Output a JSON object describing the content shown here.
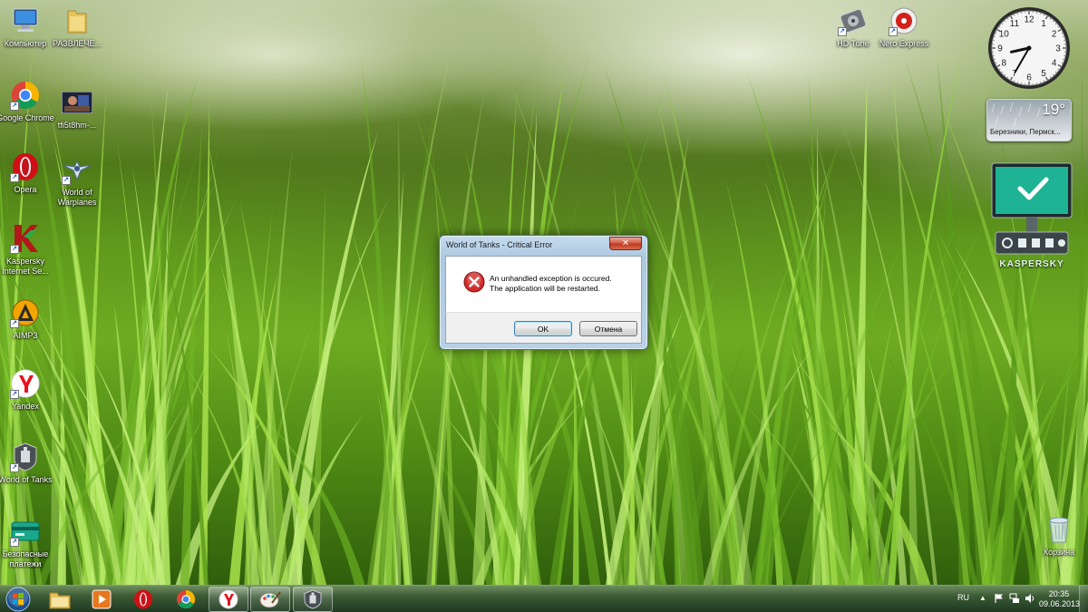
{
  "desktop": {
    "left_icons": [
      {
        "label": "Компьютер",
        "icon": "computer-icon"
      },
      {
        "label": "РАЗВЛЕЧЕ...",
        "icon": "folder-icon"
      },
      {
        "label": "Google Chrome",
        "icon": "chrome-icon"
      },
      {
        "label": "tfi5t8hm-...",
        "icon": "image-thumbnail-icon"
      },
      {
        "label": "Opera",
        "icon": "opera-icon"
      },
      {
        "label": "World of Warplanes",
        "icon": "world-of-warplanes-icon"
      },
      {
        "label": "Kaspersky Internet Se...",
        "icon": "kaspersky-icon"
      },
      {
        "label": "AIMP3",
        "icon": "aimp-icon"
      },
      {
        "label": "Yandex",
        "icon": "yandex-icon"
      },
      {
        "label": "World of Tanks",
        "icon": "world-of-tanks-icon"
      },
      {
        "label": "Безопасные платежи",
        "icon": "safe-payments-icon"
      }
    ],
    "top_right_icons": [
      {
        "label": "HD Tune",
        "icon": "hd-tune-icon"
      },
      {
        "label": "Nero Express",
        "icon": "nero-express-icon"
      }
    ],
    "recycle_bin": {
      "label": "Корзина",
      "icon": "recycle-bin-icon"
    }
  },
  "gadgets": {
    "clock": {
      "hour": 8,
      "minute": 35,
      "numbers": [
        "12",
        "1",
        "2",
        "3",
        "4",
        "5",
        "6",
        "7",
        "8",
        "9",
        "10",
        "11"
      ]
    },
    "weather": {
      "temperature": "19°",
      "location": "Березники, Пермск..."
    },
    "kaspersky": {
      "logo": "KASPERSKY",
      "status_icon": "checkmark-icon"
    }
  },
  "dialog": {
    "title": "World of Tanks - Critical Error",
    "close_glyph": "✕",
    "message_line1": "An unhandled exception is occured.",
    "message_line2": "The application will be restarted.",
    "ok_label": "OK",
    "cancel_label": "Отмена"
  },
  "taskbar": {
    "pinned": [
      {
        "name": "explorer",
        "icon": "explorer-folder-icon",
        "open": false
      },
      {
        "name": "media-player",
        "icon": "media-player-icon",
        "open": false
      },
      {
        "name": "opera",
        "icon": "opera-icon",
        "open": false
      },
      {
        "name": "chrome",
        "icon": "chrome-icon",
        "open": false
      },
      {
        "name": "yandex",
        "icon": "yandex-icon",
        "open": true
      },
      {
        "name": "paint",
        "icon": "paint-icon",
        "open": true
      },
      {
        "name": "world-of-tanks",
        "icon": "world-of-tanks-icon",
        "open": true
      }
    ],
    "tray": {
      "language": "RU",
      "time": "20:35",
      "date": "09.06.2013"
    }
  },
  "colors": {
    "dialog_frame": "#b9d1e7",
    "close_button": "#c0391f",
    "error_red": "#d22b2b",
    "kaspersky_green": "#22b59a"
  }
}
